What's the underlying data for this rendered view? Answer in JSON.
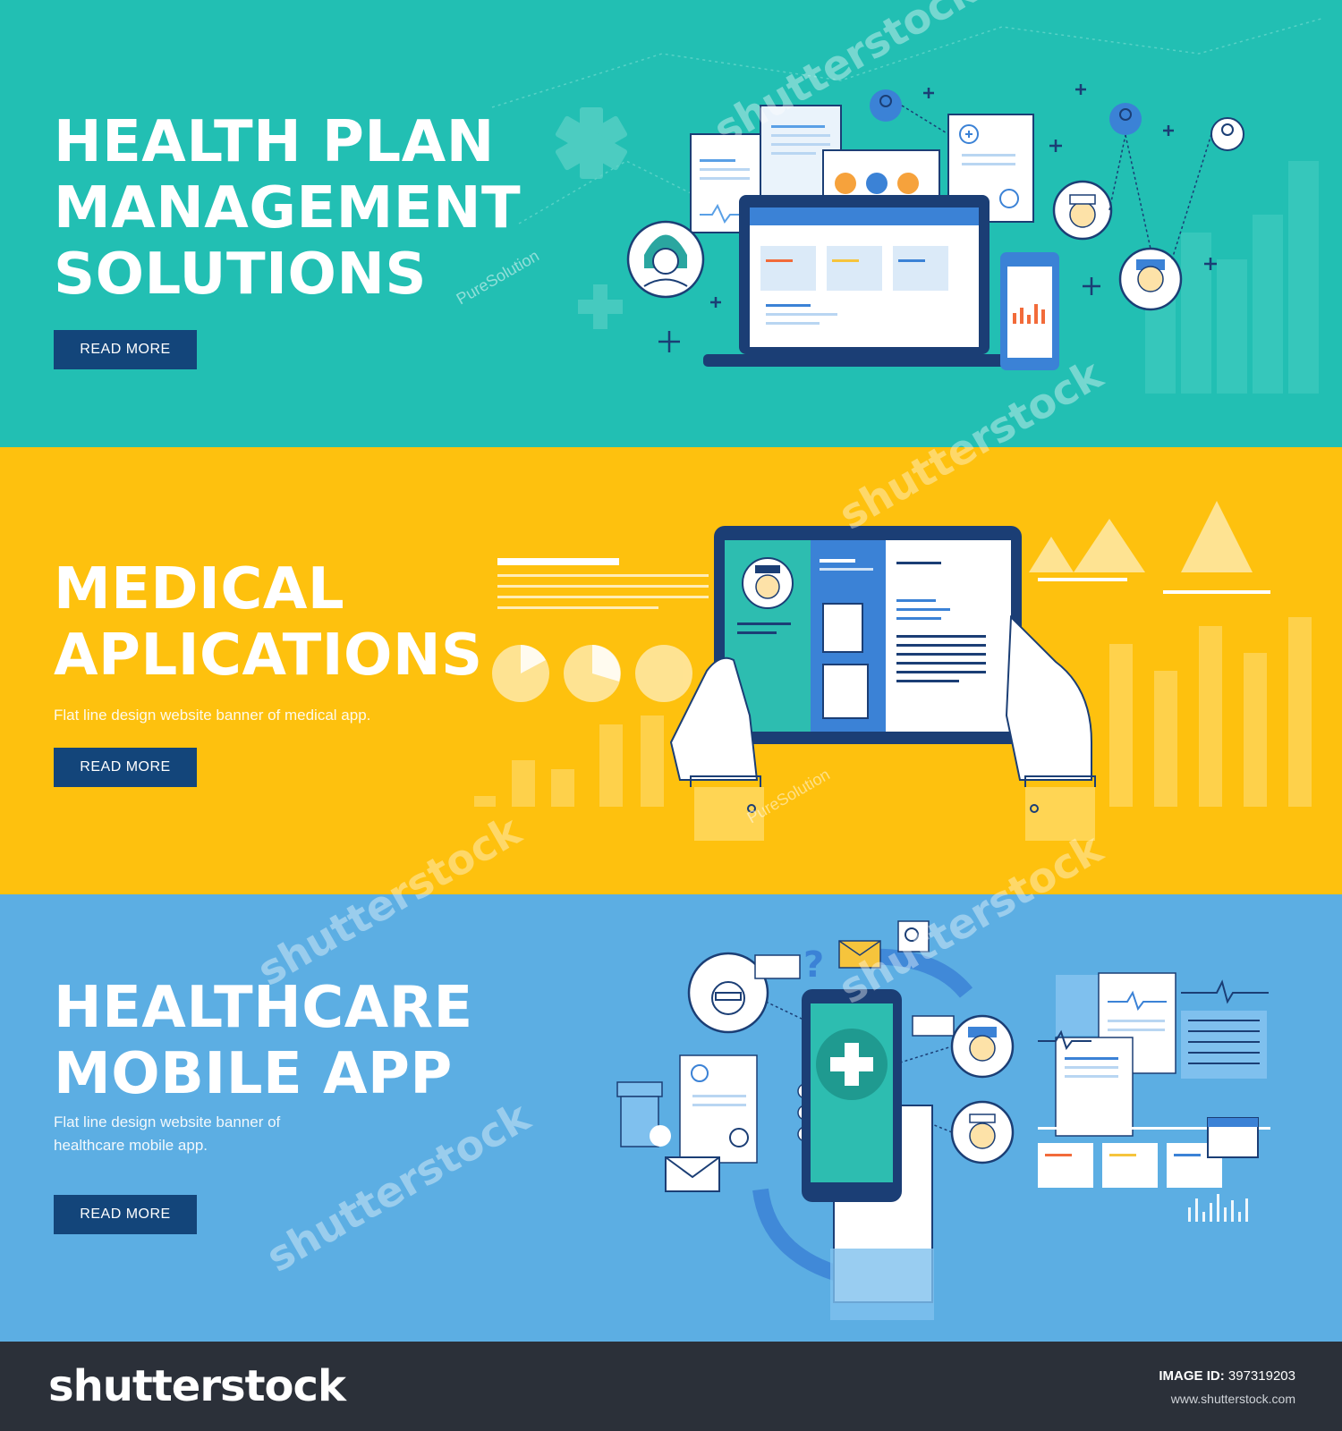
{
  "banners": [
    {
      "headline": [
        "HEALTH PLAN",
        "MANAGEMENT",
        "SOLUTIONS"
      ],
      "button_label": "READ MORE"
    },
    {
      "headline": [
        "MEDICAL",
        "APLICATIONS"
      ],
      "subtext": [
        "Flat line design website banner of medical app."
      ],
      "button_label": "READ MORE"
    },
    {
      "headline": [
        "HEALTHCARE",
        "MOBILE APP"
      ],
      "subtext": [
        "Flat line design website banner of",
        "healthcare mobile app."
      ],
      "button_label": "READ MORE"
    }
  ],
  "watermark": {
    "brand": "shutterstock",
    "author": "PureSolution"
  },
  "footer": {
    "logo": "shutterstock",
    "image_id_label": "IMAGE ID:",
    "image_id_value": "397319203",
    "site": "www.shutterstock.com"
  },
  "colors": {
    "teal": "#22bfb3",
    "yellow": "#fec10e",
    "blue": "#5caee3",
    "navy": "#13457a",
    "footer": "#2b3039"
  }
}
